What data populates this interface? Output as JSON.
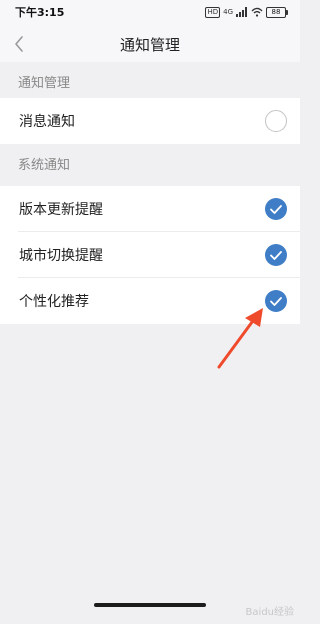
{
  "status_bar": {
    "time": "下午3:15",
    "hd": "HD",
    "network": "4G",
    "battery": "88"
  },
  "nav": {
    "title": "通知管理"
  },
  "sections": [
    {
      "header": "通知管理",
      "rows": [
        {
          "label": "消息通知",
          "checked": false
        }
      ]
    },
    {
      "header": "系统通知",
      "rows": [
        {
          "label": "版本更新提醒",
          "checked": true
        },
        {
          "label": "城市切换提醒",
          "checked": true
        },
        {
          "label": "个性化推荐",
          "checked": true
        }
      ]
    }
  ],
  "annotation": {
    "arrow_color": "#ef4a2c"
  },
  "watermark": "Baidu经验",
  "colors": {
    "accent": "#3f7ec7",
    "background": "#f0f0f2"
  }
}
